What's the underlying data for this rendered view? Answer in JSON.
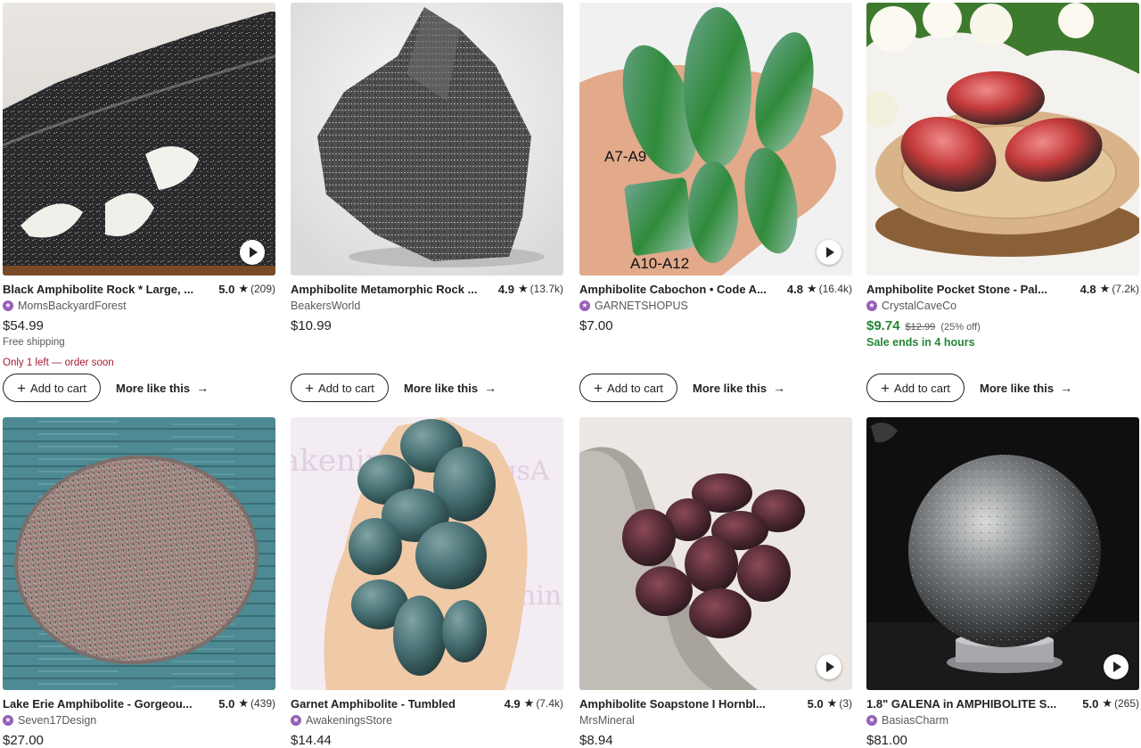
{
  "listings": [
    {
      "title": "Black Amphibolite Rock * Large, ...",
      "rating": "5.0",
      "review_count": "(209)",
      "shop": "MomsBackyardForest",
      "star_seller": true,
      "price": "$54.99",
      "shipping": "Free shipping",
      "stock_note": "Only 1 left — order soon",
      "add_to_cart": "Add to cart",
      "more_like_this": "More like this",
      "has_video": true
    },
    {
      "title": "Amphibolite Metamorphic Rock ...",
      "rating": "4.9",
      "review_count": "(13.7k)",
      "shop": "BeakersWorld",
      "star_seller": false,
      "price": "$10.99",
      "add_to_cart": "Add to cart",
      "more_like_this": "More like this",
      "has_video": false
    },
    {
      "title": "Amphibolite Cabochon • Code A...",
      "rating": "4.8",
      "review_count": "(16.4k)",
      "shop": "GARNETSHOPUS",
      "star_seller": true,
      "price": "$7.00",
      "add_to_cart": "Add to cart",
      "more_like_this": "More like this",
      "has_video": true,
      "image_labels": [
        "A7-A9",
        "A10-A12"
      ]
    },
    {
      "title": "Amphibolite Pocket Stone - Pal...",
      "rating": "4.8",
      "review_count": "(7.2k)",
      "shop": "CrystalCaveCo",
      "star_seller": true,
      "sale_price": "$9.74",
      "original_price": "$12.99",
      "discount": "(25% off)",
      "sale_note": "Sale ends in 4 hours",
      "add_to_cart": "Add to cart",
      "more_like_this": "More like this",
      "has_video": false
    },
    {
      "title": "Lake Erie Amphibolite - Gorgeou...",
      "rating": "5.0",
      "review_count": "(439)",
      "shop": "Seven17Design",
      "star_seller": true,
      "price": "$27.00",
      "has_video": false
    },
    {
      "title": "Garnet Amphibolite - Tumbled",
      "rating": "4.9",
      "review_count": "(7.4k)",
      "shop": "AwakeningsStore",
      "star_seller": true,
      "price": "$14.44",
      "has_video": false
    },
    {
      "title": "Amphibolite Soapstone I Hornbl...",
      "rating": "5.0",
      "review_count": "(3)",
      "shop": "MrsMineral",
      "star_seller": false,
      "price": "$8.94",
      "has_video": true
    },
    {
      "title": "1.8\" GALENA in AMPHIBOLITE S...",
      "rating": "5.0",
      "review_count": "(265)",
      "shop": "BasiasCharm",
      "star_seller": true,
      "price": "$81.00",
      "has_video": true
    }
  ],
  "icons": {
    "star": "star-icon",
    "star_seller": "star-seller-badge-icon",
    "plus": "plus-icon",
    "arrow": "arrow-right-icon",
    "play": "play-icon"
  },
  "colors": {
    "sale_green": "#258635",
    "stock_red": "#a61a2e",
    "star_seller_purple": "#9560b8"
  }
}
